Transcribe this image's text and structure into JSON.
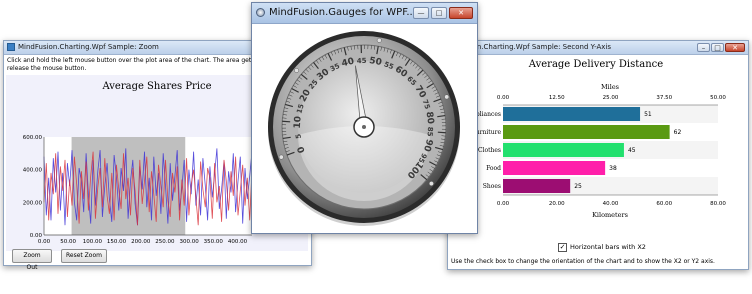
{
  "zoom_window": {
    "title": "MindFusion.Charting.Wpf Sample: Zoom",
    "instructions_line1": "Click and hold the left mouse button over the plot area of the chart. The area gets selected and is",
    "instructions_line2": "release the mouse button.",
    "zoom_out_label": "Zoom Out",
    "reset_zoom_label": "Reset Zoom"
  },
  "gauge_window": {
    "title": "MindFusion.Gauges for WPF...",
    "minimize_glyph": "—",
    "maximize_glyph": "□",
    "close_glyph": "✕",
    "dial_labels": [
      "0",
      "5",
      "10",
      "15",
      "20",
      "25",
      "30",
      "35",
      "40",
      "45",
      "50",
      "55",
      "60",
      "65",
      "70",
      "75",
      "80",
      "85",
      "90",
      "95",
      "100"
    ]
  },
  "axis_window": {
    "title": "MindFusion.Charting.Wpf Sample: Second Y-Axis",
    "checkbox_label": "Horizontal bars with X2",
    "checkbox_checked": true,
    "hint": "Use the check box to change the orientation of the chart and to show the X2 or Y2 axis."
  },
  "colors": {
    "series1": "#3b2fd6",
    "series2": "#d9313a",
    "selection": "#bfbfbf",
    "bar_appliances": "#1f6f9a",
    "bar_furniture": "#5a9a12",
    "bar_clothes": "#22e06e",
    "bar_food": "#ff1faa",
    "bar_shoes": "#9c0d72"
  },
  "chart_data": [
    {
      "type": "line",
      "title": "Average Shares Price",
      "ylim": [
        0,
        600
      ],
      "xlim": [
        0,
        430
      ],
      "y_ticks": [
        "0.00",
        "200.00",
        "400.00",
        "600.00"
      ],
      "x_ticks": [
        "0.00",
        "50.00",
        "100.00",
        "150.00",
        "200.00",
        "250.00",
        "300.00",
        "350.00",
        "400.00"
      ],
      "selection_range": [
        57,
        292
      ],
      "series": [
        {
          "values": [
            480,
            120,
            350,
            90,
            470,
            260,
            510,
            150,
            380,
            60,
            440,
            300,
            520,
            200,
            90,
            410,
            330,
            140,
            500,
            250,
            70,
            460,
            180,
            390,
            520,
            110,
            300,
            440,
            220,
            80,
            490,
            360,
            150,
            410,
            270,
            530,
            100,
            330,
            460,
            190,
            60,
            420,
            280,
            510,
            170,
            350,
            90,
            480,
            240,
            380,
            130,
            500,
            300,
            70,
            440,
            210,
            360,
            520,
            150,
            290,
            460,
            80,
            400,
            250,
            510,
            180,
            340,
            120,
            470,
            300,
            90,
            420,
            230,
            370,
            530,
            160,
            280,
            450,
            100,
            390,
            260,
            500,
            140,
            330,
            480,
            70,
            410,
            220,
            360,
            510
          ]
        },
        {
          "values": [
            200,
            440,
            90,
            380,
            250,
            500,
            130,
            420,
            270,
            460,
            110,
            340,
            180,
            480,
            310,
            70,
            390,
            220,
            450,
            150,
            360,
            510,
            100,
            290,
            410,
            170,
            470,
            240,
            130,
            380,
            90,
            430,
            280,
            160,
            500,
            220,
            350,
            120,
            410,
            270,
            60,
            460,
            190,
            330,
            480,
            140,
            390,
            250,
            80,
            430,
            300,
            170,
            460,
            210,
            110,
            380,
            260,
            420,
            90,
            340,
            180,
            470,
            120,
            310,
            400,
            230,
            60,
            450,
            280,
            170,
            410,
            350,
            100,
            440,
            200,
            300,
            80,
            460,
            330,
            150,
            390,
            240,
            480,
            120,
            270,
            430,
            180,
            350,
            90,
            400
          ]
        }
      ]
    },
    {
      "type": "bar",
      "title": "Average Delivery Distance",
      "xlabel_top": "Miles",
      "xlabel": "Kilometers",
      "x2_ticks": [
        "0.00",
        "12.50",
        "25.00",
        "37.50",
        "50.00"
      ],
      "x_ticks": [
        "0.00",
        "20.00",
        "40.00",
        "60.00",
        "80.00"
      ],
      "xlim": [
        0,
        80
      ],
      "categories": [
        "Appliances",
        "Furniture",
        "Clothes",
        "Food",
        "Shoes"
      ],
      "category_labels": [
        "pliances",
        "urniture",
        "Clothes",
        "Food",
        "Shoes"
      ],
      "values": [
        51,
        62,
        45,
        38,
        25
      ]
    }
  ]
}
